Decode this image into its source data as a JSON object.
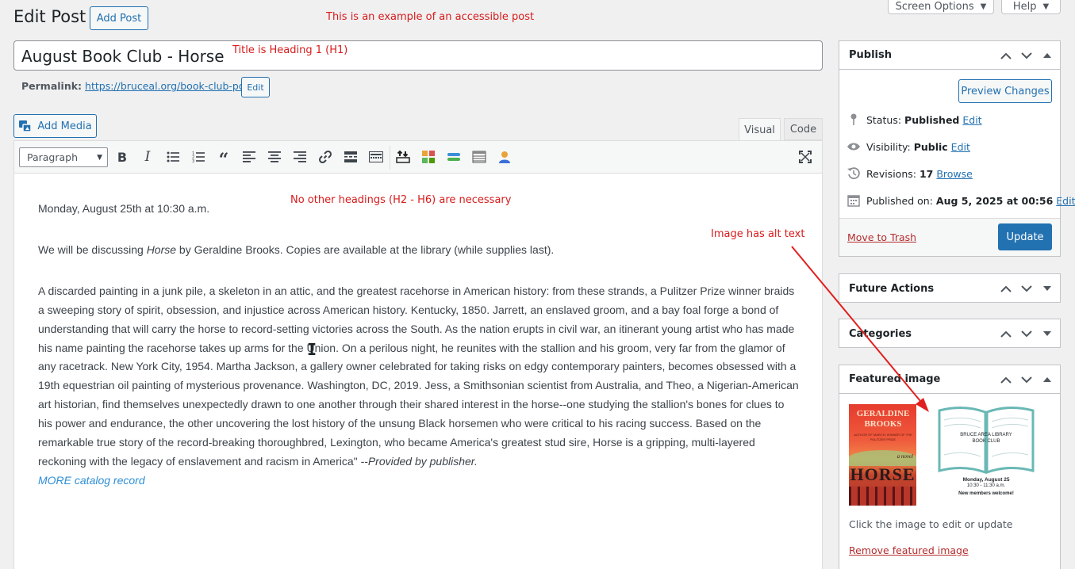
{
  "header": {
    "title": "Edit Post",
    "add_post_label": "Add Post",
    "screen_options_label": "Screen Options",
    "help_label": "Help"
  },
  "annotations": {
    "accessible_post": "This is an example of an accessible post",
    "title_heading": "Title is Heading 1 (H1)",
    "no_headings": "No other headings (H2 - H6) are necessary",
    "alt_text": "Image has alt text",
    "arrow_color": "#e0201f"
  },
  "post": {
    "title": "August Book Club - Horse",
    "permalink_label": "Permalink:",
    "permalink_url": "https://bruceal.org/book-club-post/",
    "permalink_edit_label": "Edit"
  },
  "editor": {
    "add_media_label": "Add Media",
    "tab_visual": "Visual",
    "tab_code": "Code",
    "format_select": "Paragraph",
    "content": {
      "date_line": "Monday, August 25th at 10:30 a.m.",
      "discuss_pre": "We will be discussing ",
      "discuss_book": "Horse",
      "discuss_post": " by Geraldine Brooks. Copies are available at the library (while supplies last).",
      "synopsis": "A discarded painting in a junk pile, a skeleton in an attic, and the greatest racehorse in American history: from these strands, a Pulitzer Prize winner braids a sweeping story of spirit, obsession, and injustice across American history. Kentucky, 1850. Jarrett, an enslaved groom, and a bay foal forge a bond of understanding that will carry the horse to record-setting victories across the South. As the nation erupts in civil war, an itinerant young artist who has made his name painting the racehorse takes up arms for the Union. On a perilous night, he reunites with the stallion and his groom, very far from the glamor of any racetrack. New York City, 1954. Martha Jackson, a gallery owner celebrated for taking risks on edgy contemporary painters, becomes obsessed with a 19th equestrian oil painting of mysterious provenance. Washington, DC, 2019. Jess, a Smithsonian scientist from Australia, and Theo, a Nigerian-American art historian, find themselves unexpectedly drawn to one another through their shared interest in the horse--one studying the stallion's bones for clues to his power and endurance, the other uncovering the lost history of the unsung Black horsemen who were critical to his racing success. Based on the remarkable true story of the record-breaking thoroughbred, Lexington, who became America's greatest stud sire, Horse is a gripping, multi-layered reckoning with the legacy of enslavement and racism in America\" ",
      "provided_by": "--Provided by publisher.",
      "catalog_link": "MORE catalog record"
    }
  },
  "publish": {
    "title": "Publish",
    "preview_label": "Preview Changes",
    "status_label": "Status:",
    "status_value": "Published",
    "visibility_label": "Visibility:",
    "visibility_value": "Public",
    "revisions_label": "Revisions:",
    "revisions_value": "17",
    "browse_label": "Browse",
    "published_on_label": "Published on:",
    "published_on_value": "Aug 5, 2025 at 00:56",
    "edit_label": "Edit",
    "trash_label": "Move to Trash",
    "update_label": "Update"
  },
  "future_actions": {
    "title": "Future Actions"
  },
  "categories": {
    "title": "Categories"
  },
  "featured_image": {
    "title": "Featured image",
    "book_author": "GERALDINE BROOKS",
    "book_blurb": "AUTHOR OF MARCH, WINNER OF THE PULITZER PRIZE",
    "book_word": "a novel",
    "book_title": "HORSE",
    "club_line1": "BRUCE AREA LIBRARY",
    "club_line2": "BOOK CLUB",
    "club_date": "Monday, August 25",
    "club_time": "10:30 - 11:30 a.m.",
    "club_welcome": "New members welcome!",
    "hint": "Click the image to edit or update",
    "remove_label": "Remove featured image"
  }
}
